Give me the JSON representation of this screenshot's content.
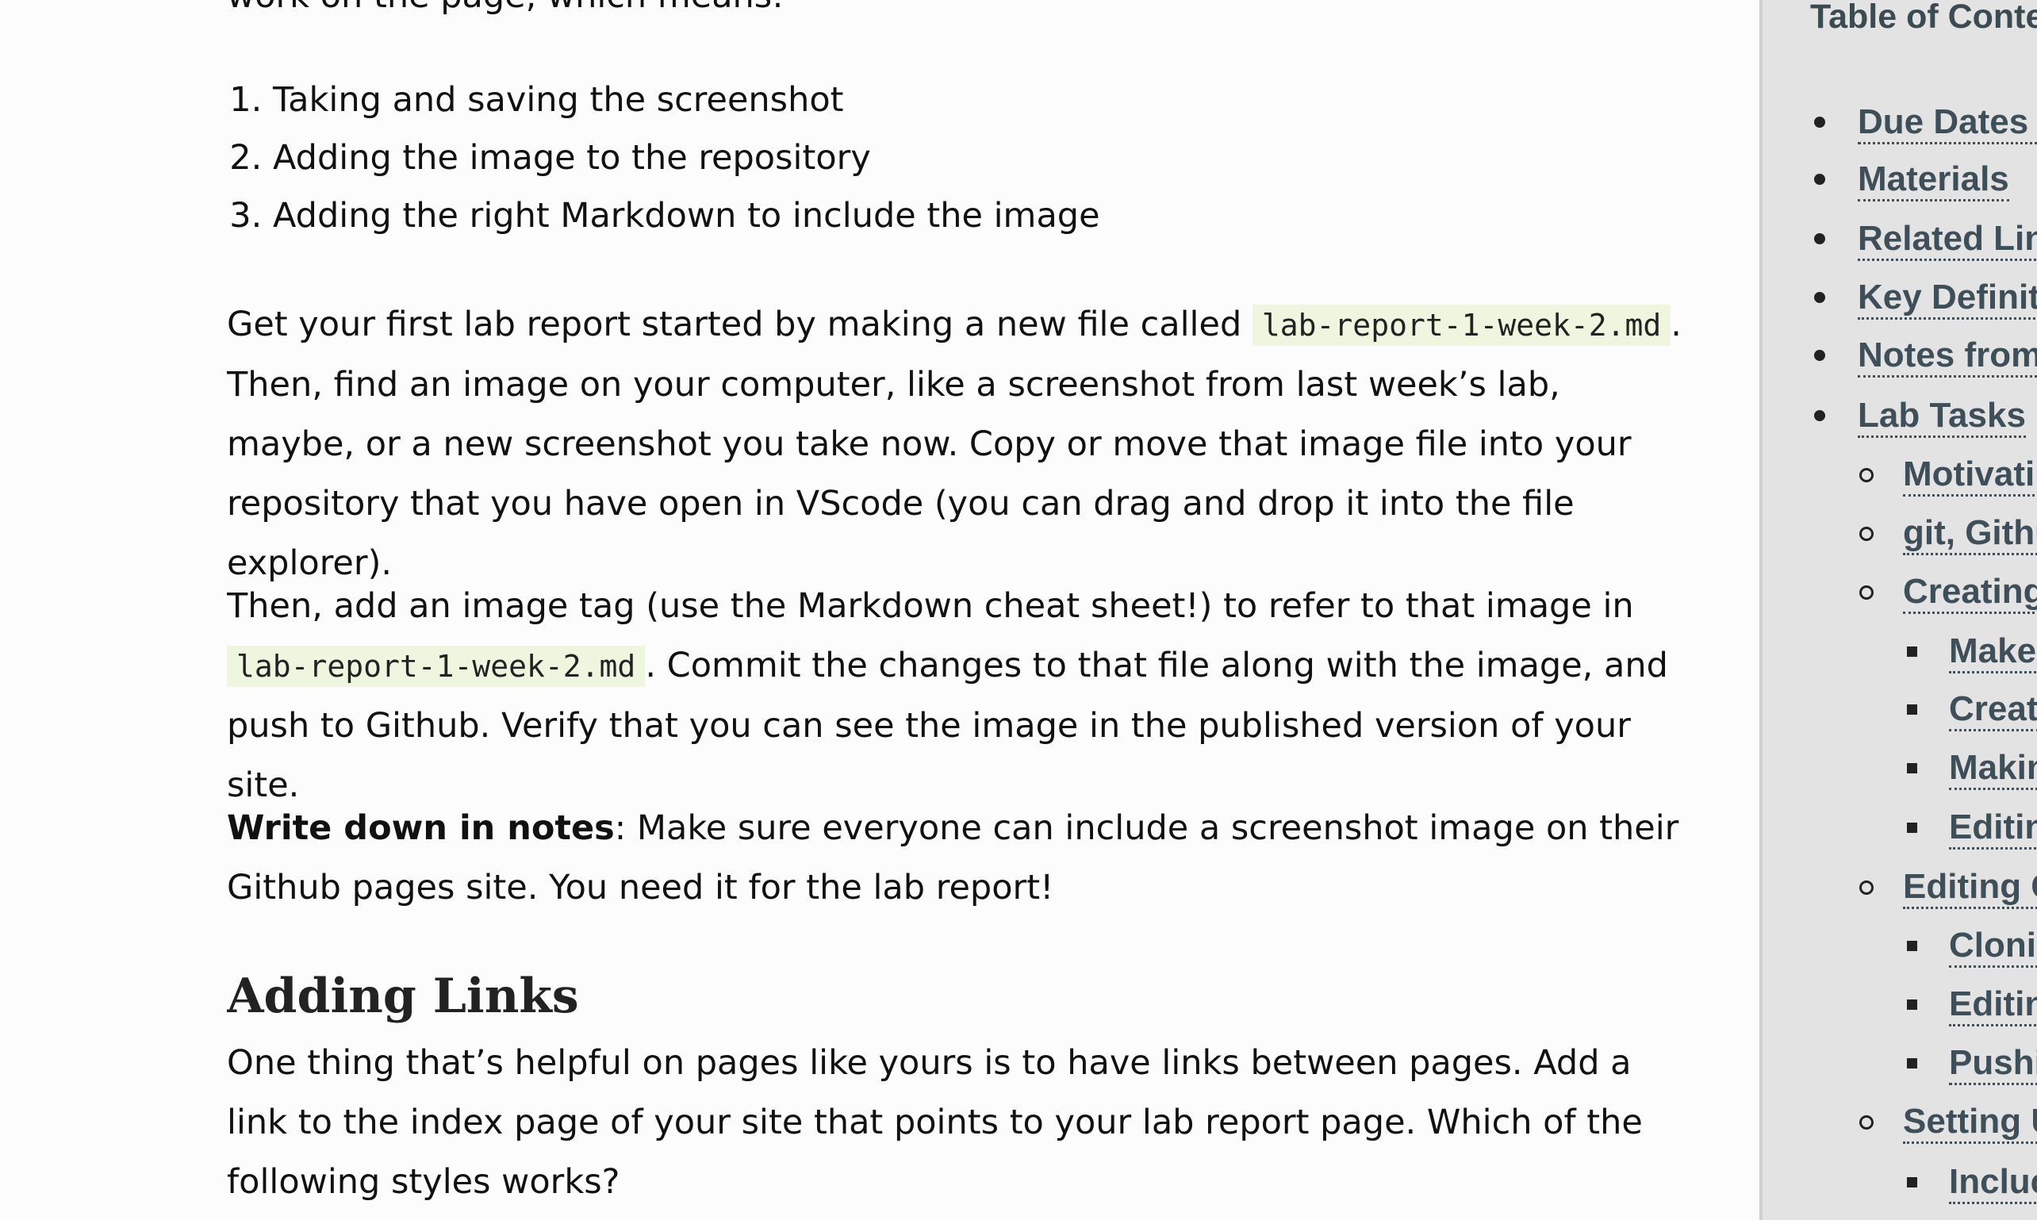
{
  "main": {
    "cut_text": "work on the page, which means:",
    "steps": [
      "Taking and saving the screenshot",
      "Adding the image to the repository",
      "Adding the right Markdown to include the image"
    ],
    "para1": {
      "before": "Get your first lab report started by making a new file called ",
      "code": "lab-report-1-week-2.md",
      "after": ". Then, find an image on your computer, like a screenshot from last week’s lab, maybe, or a new screenshot you take now. Copy or move that image file into your repository that you have open in VScode (you can drag and drop it into the file explorer)."
    },
    "para2": {
      "before": "Then, add an image tag (use the Markdown cheat sheet!) to refer to that image in ",
      "code": "lab-report-1-week-2.md",
      "after": ". Commit the changes to that file along with the image, and push to Github. Verify that you can see the image in the published version of your site."
    },
    "para3": {
      "bold": "Write down in notes",
      "after": ": Make sure everyone can include a screenshot image on their Github pages site. You need it for the lab report!"
    },
    "heading": "Adding Links",
    "para4": "One thing that’s helpful on pages like yours is to have links between pages. Add a link to the index page of your site that points to your lab report page. Which of the following styles works?"
  },
  "toc": {
    "title": "Table of Conte",
    "items": [
      {
        "label": "Due Dates a",
        "level": 1
      },
      {
        "label": "Materials",
        "level": 1
      },
      {
        "label": "Related Lin",
        "level": 1
      },
      {
        "label": "Key Definit",
        "level": 1
      },
      {
        "label": "Notes from",
        "level": 1
      },
      {
        "label": "Lab Tasks",
        "level": 1
      },
      {
        "label": "Motivati",
        "level": 2
      },
      {
        "label": "git, Githu",
        "level": 2
      },
      {
        "label": "Creating",
        "level": 2
      },
      {
        "label": "Make",
        "level": 3
      },
      {
        "label": "Creat",
        "level": 3
      },
      {
        "label": "Makin",
        "level": 3
      },
      {
        "label": "Editin",
        "level": 3
      },
      {
        "label": "Editing C",
        "level": 2
      },
      {
        "label": "Clonin",
        "level": 3
      },
      {
        "label": "Editin",
        "level": 3
      },
      {
        "label": "Pushi",
        "level": 3
      },
      {
        "label": "Setting U",
        "level": 2
      },
      {
        "label": "Incluc",
        "level": 3
      }
    ]
  }
}
